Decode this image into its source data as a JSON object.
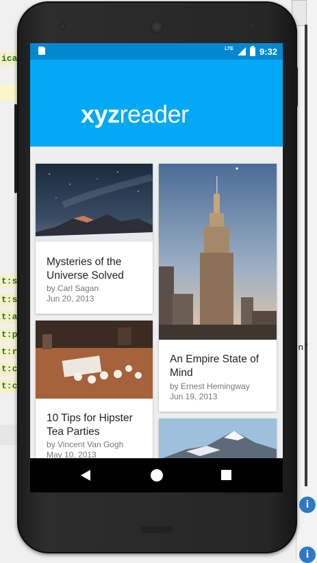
{
  "ide": {
    "code_fragments": [
      "ica",
      "t:s",
      "t:s",
      "t:a",
      "t:p",
      "t:r",
      "t:c",
      "t:c"
    ],
    "right_fragment": "n\"",
    "info_icon_glyph": "i"
  },
  "status_bar": {
    "network": "LTE",
    "time": "9:32",
    "bar_color": "#0288d1"
  },
  "app": {
    "logo_bold": "xyz",
    "logo_regular": "reader",
    "toolbar_color": "#03a9f4"
  },
  "articles": [
    {
      "title": "Mysteries of the Universe Solved",
      "author": "by Carl Sagan",
      "date": "Jun 20, 2013",
      "image": "night-sky-mountains"
    },
    {
      "title": "10 Tips for Hipster Tea Parties",
      "author": "by Vincent Van Gogh",
      "date": "May 10, 2013",
      "image": "tea-cups-on-table"
    },
    {
      "title": "An Empire State of Mind",
      "author": "by Ernest Hemingway",
      "date": "Jun 19, 2013",
      "image": "empire-state-building"
    },
    {
      "title": "",
      "author": "",
      "date": "",
      "image": "snowy-mountain"
    }
  ],
  "nav_bar": {
    "back_icon": "back-triangle-icon",
    "home_icon": "home-circle-icon",
    "recents_icon": "recents-square-icon"
  }
}
